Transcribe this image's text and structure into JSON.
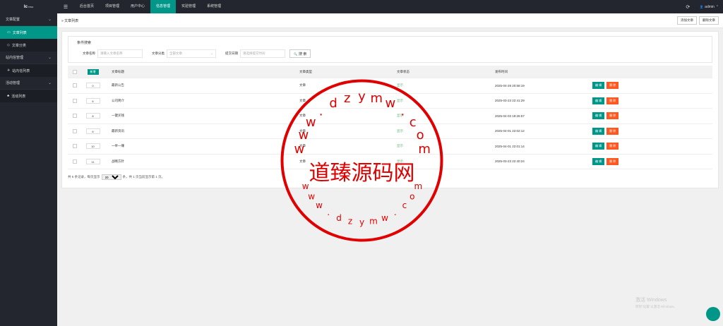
{
  "topbar": {
    "logo": "lc",
    "logo_sup": "TPL3",
    "menu_icon": "☰",
    "nav": [
      {
        "label": "后台首页"
      },
      {
        "label": "项目管理"
      },
      {
        "label": "用户中心"
      },
      {
        "label": "信息管理"
      },
      {
        "label": "实验管理"
      },
      {
        "label": "系统管理"
      }
    ],
    "refresh_icon": "⟳",
    "user_icon": "👤",
    "user": "admin",
    "user_caret": "⌃"
  },
  "sidebar": {
    "groups": [
      {
        "label": "文章配置",
        "chev": "⌄"
      },
      {
        "label": "站内信管理",
        "chev": "⌄"
      },
      {
        "label": "活动管理",
        "chev": "⌄"
      }
    ],
    "items": [
      {
        "label": "文章列表",
        "icon": "▭"
      },
      {
        "label": "文章分类",
        "icon": "◇"
      },
      {
        "label": "站内信列表",
        "icon": "✈"
      },
      {
        "label": "活动列表",
        "icon": "♣"
      }
    ]
  },
  "header": {
    "crumb": "» 文章列表",
    "add_btn": "添加文章",
    "delete_btn": "删除文章"
  },
  "search": {
    "legend": "条件搜索",
    "name_label": "文章名称",
    "name_placeholder": "请输入文章名称",
    "cat_label": "文章分类",
    "cat_value": "全部文章",
    "date_label": "提交日期",
    "date_placeholder": "请选择提交时间",
    "btn_label": "搜 索",
    "btn_icon": "🔍"
  },
  "table": {
    "new_btn": "新增",
    "headers": {
      "title": "文章标题",
      "type": "文章类型",
      "status": "文章状态",
      "time": "发布时间"
    },
    "edit_label": "编 辑",
    "del_label": "删 除",
    "rows": [
      {
        "sort": "0",
        "title": "最新公告",
        "type": "文章",
        "status": "显示",
        "time": "2025-04-28 20:58:19"
      },
      {
        "sort": "6",
        "title": "公司简介",
        "type": "文章",
        "status": "显示",
        "time": "2025-03-23 22:41:29"
      },
      {
        "sort": "8",
        "title": "一键买钱",
        "type": "文章",
        "status": "显示",
        "time": "2025-04-03 19:26:57"
      },
      {
        "sort": "6",
        "title": "最新资讯",
        "type": "文章",
        "status": "显示",
        "time": "2025-04-01 22:02:12"
      },
      {
        "sort": "10",
        "title": "一举一赚",
        "type": "文章",
        "status": "显示",
        "time": "2025-04-01 22:01:14"
      },
      {
        "sort": "11",
        "title": "战略方针",
        "type": "文章",
        "status": "显示",
        "time": "2025-03-23 22:40:24"
      }
    ]
  },
  "pager": {
    "prefix": "共 6 条记录，每页显示",
    "per_page": "20",
    "suffix": "条，共 1 页当前显示第 1 页。"
  },
  "watermark": {
    "center_text": "道臻源码网",
    "ring_top": "www.dzymw.com",
    "ring_bottom": "www.dzymw.com",
    "color": "#e00000"
  },
  "activate": {
    "line1": "激活 Windows",
    "line2": "转到\"设置\"以激活 Windows。"
  }
}
